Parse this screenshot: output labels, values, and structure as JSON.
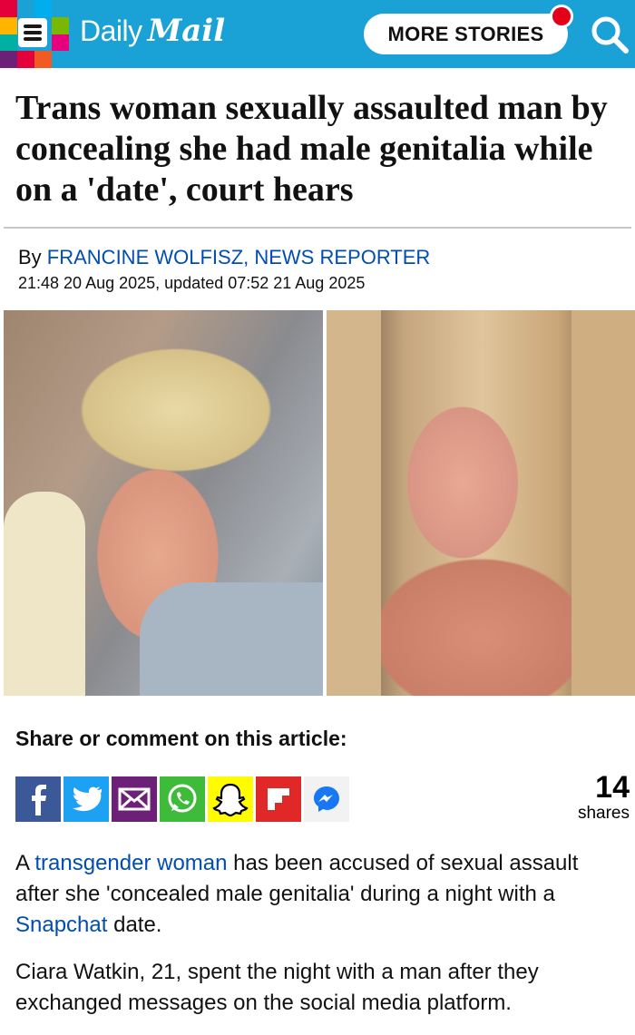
{
  "header": {
    "logo_daily": "Daily",
    "logo_mail": "Mail",
    "more_stories_label": "MORE STORIES",
    "menu_colors": [
      "#e4003b",
      "#1aa1d6",
      "#00aeef",
      "#1aa1d6",
      "#ffb400",
      "#1aa1d6",
      "#1aa1d6",
      "#7ab800",
      "#00b0a0",
      "#1aa1d6",
      "#1aa1d6",
      "#e6007e",
      "#6d2077",
      "#e4003b",
      "#f15a22",
      "#1aa1d6"
    ],
    "accent_color": "#1aa1d6",
    "notification_color": "#e4001b",
    "search_icon": "search-icon"
  },
  "article": {
    "headline": "Trans woman sexually assaulted man by concealing she had male genitalia while on a 'date', court hears",
    "byline_prefix": "By ",
    "author": "FRANCINE WOLFISZ, NEWS REPORTER",
    "dateline": "21:48 20 Aug 2025, updated 07:52 21 Aug 2025"
  },
  "share": {
    "title": "Share or comment on this article:",
    "count": "14",
    "count_label": "shares",
    "icons": [
      {
        "name": "facebook-icon",
        "color": "#3b5998"
      },
      {
        "name": "twitter-icon",
        "color": "#1da1f2"
      },
      {
        "name": "email-icon",
        "color": "#6d2077"
      },
      {
        "name": "whatsapp-icon",
        "color": "#3fbb3a"
      },
      {
        "name": "snapchat-icon",
        "color": "#fffc00"
      },
      {
        "name": "flipboard-icon",
        "color": "#e12828"
      },
      {
        "name": "messenger-icon",
        "color": "#f2f2f2"
      }
    ]
  },
  "body": {
    "p1_a": "A ",
    "p1_link1": "transgender woman",
    "p1_b": " has been accused of sexual assault after she 'concealed male genitalia' during a night with a ",
    "p1_link2": "Snapchat",
    "p1_c": " date.",
    "p2": "Ciara Watkin, 21, spent the night with a man after they exchanged messages on the social media platform."
  }
}
